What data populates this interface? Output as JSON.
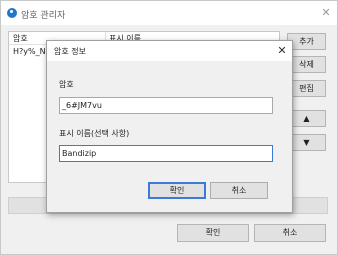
{
  "window": {
    "title": "암호 관리자",
    "close_glyph": "✕"
  },
  "list": {
    "columns": [
      "암호",
      "표시 이름"
    ],
    "rows": [
      {
        "password": "H?y%_N2K",
        "display_name": ""
      }
    ]
  },
  "side_buttons": {
    "add": "추가",
    "delete": "삭제",
    "edit": "편집",
    "up": "▲",
    "down": "▼"
  },
  "bottom_buttons": {
    "ok": "확인",
    "cancel": "취소"
  },
  "dialog": {
    "title": "암호 정보",
    "close_glyph": "✕",
    "password_label": "암호",
    "password_value": "_6#JM7vu",
    "display_name_label": "표시 이름(선택 사항)",
    "display_name_value": "Bandizip",
    "ok_label": "확인",
    "cancel_label": "취소"
  },
  "colors": {
    "accent": "#3b7bd6",
    "app_icon": "#1f78c8"
  }
}
